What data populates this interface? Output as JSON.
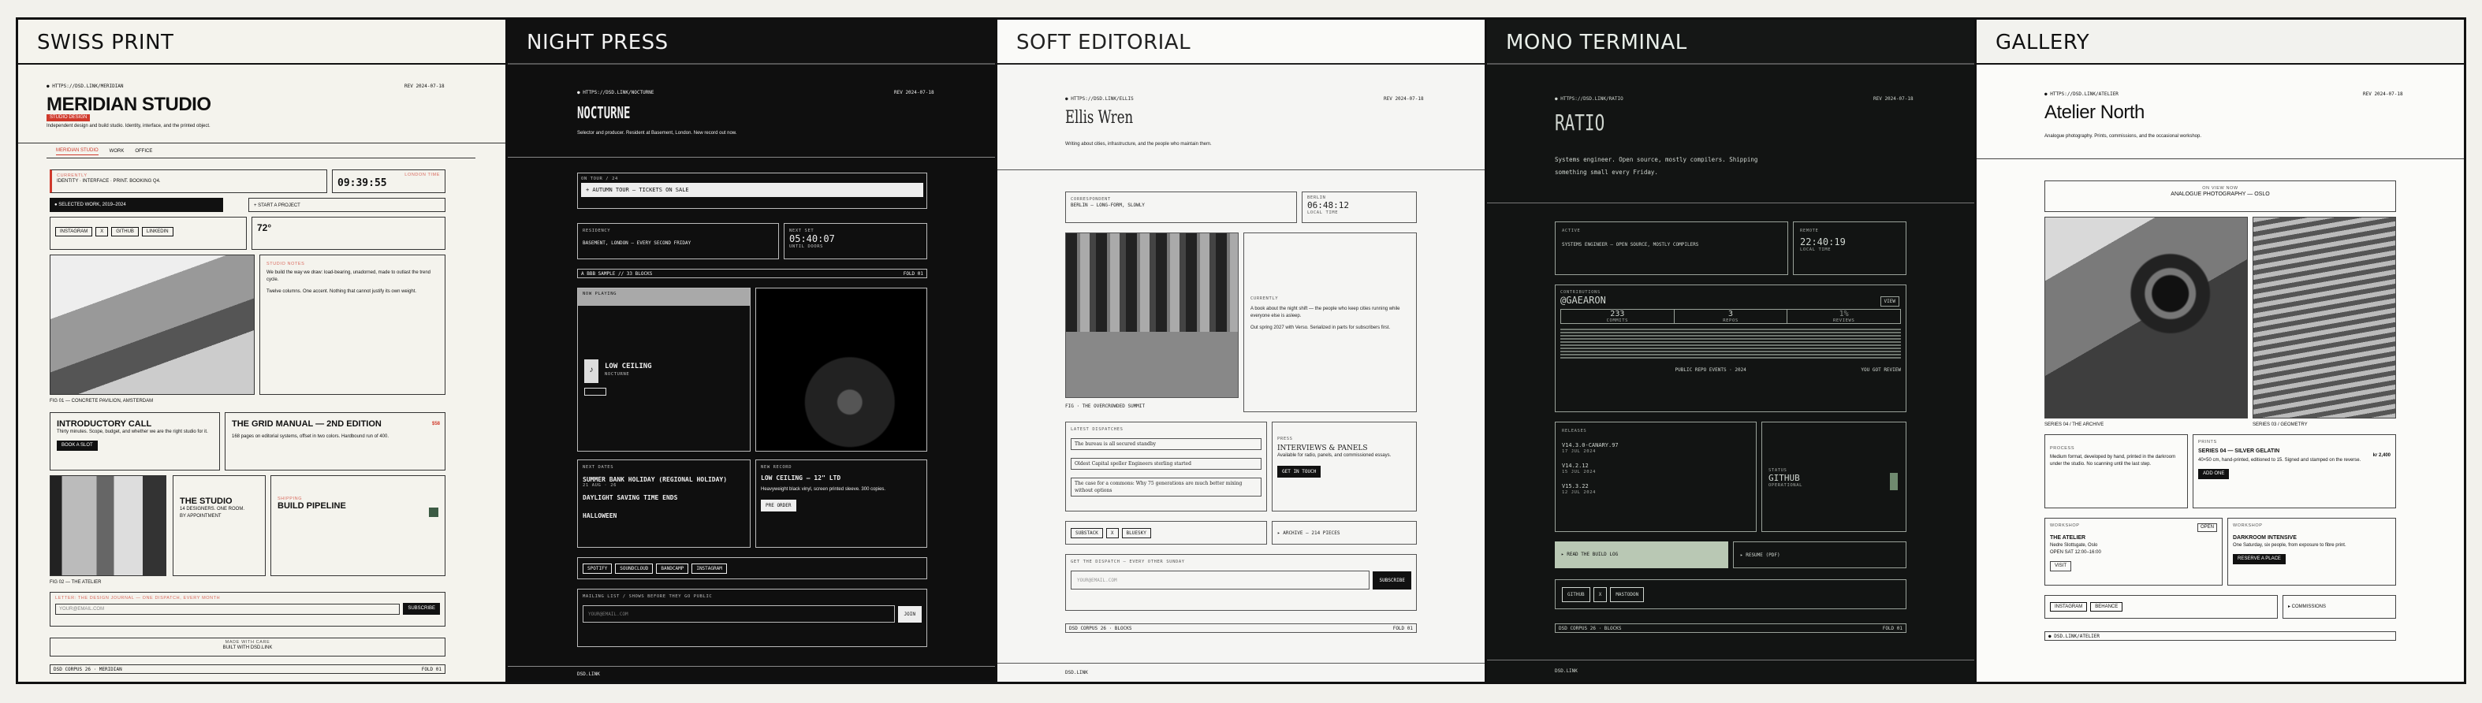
{
  "panels": {
    "swiss": {
      "label": "SWISS PRINT",
      "url": "● HTTPS://DSD.LINK/MERIDIAN",
      "date": "REV 2024-07-18",
      "title": "MERIDIAN STUDIO",
      "badge": "STUDIO DESIGN",
      "tagline": "Independent design and build studio. Identity, interface, and the printed object.",
      "nav": [
        "MERIDIAN STUDIO",
        "WORK",
        "OFFICE"
      ],
      "currently_label": "CURRENTLY",
      "currently": "IDENTITY · INTERFACE · PRINT. BOOKING Q4.",
      "clock_label": "LONDON TIME",
      "clock": "09:39:55",
      "selected": "● SELECTED WORK, 2019–2024",
      "start": "+ START A PROJECT",
      "socials": [
        "INSTAGRAM",
        "X",
        "GITHUB",
        "LINKEDIN"
      ],
      "temp": "72°",
      "caption1": "FIG 01 — CONCRETE PAVILION, AMSTERDAM",
      "studio_note_label": "STUDIO NOTES",
      "studio_note": "We build the way we draw: load-bearing, unadorned, made to outlast the trend cycle.",
      "studio_note2": "Twelve columns. One accent. Nothing that cannot justify its own weight.",
      "call_title": "INTRODUCTORY CALL",
      "call_text": "Thirty minutes. Scope, budget, and whether we are the right studio for it.",
      "call_btn": "BOOK A SLOT",
      "book_title": "THE GRID MANUAL — 2ND EDITION",
      "book_price": "$58",
      "book_text": "168 pages on editorial systems, offset in two colors. Hardbound run of 400.",
      "caption2": "FIG 02 — THE ATELIER",
      "atelier_title": "THE STUDIO",
      "atelier_text": "14 DESIGNERS. ONE ROOM.",
      "atelier_sub": "BY APPOINTMENT",
      "shipping_title": "BUILD PIPELINE",
      "shipping_label": "SHIPPING",
      "newsletter_label": "LETTER: THE DESIGN JOURNAL — ONE DISPATCH, EVERY MONTH",
      "email_ph": "YOUR@EMAIL.COM",
      "subscribe": "SUBSCRIBE",
      "built_label": "MADE WITH CARE",
      "built": "BUILT WITH DSD.LINK",
      "footer": "DSD CORPUS 26 · MERIDIAN",
      "footer_r": "FOLD 01"
    },
    "night": {
      "label": "NIGHT PRESS",
      "url": "● HTTPS://DSD.LINK/NOCTURNE",
      "date": "REV 2024-07-18",
      "title": "NOCTURNE",
      "tagline": "Selector and producer. Resident at Basement, London. New record out now.",
      "tour_label": "ON TOUR / 24",
      "tour": "+ AUTUMN TOUR — TICKETS ON SALE",
      "residency_label": "RESIDENCY",
      "residency": "BASEMENT, LONDON — EVERY SECOND FRIDAY",
      "clock_label": "NEXT SET",
      "clock": "05:40:07",
      "clock_sub": "UNTIL DOORS",
      "marquee": "A BBB SAMPLE // 33 BLOCKS",
      "marquee_r": "FOLD 01",
      "now_label": "NOW PLAYING",
      "track": "LOW CEILING",
      "track_sub": "NOCTURNE",
      "events_label": "NEXT DATES",
      "ev1": "SUMMER BANK HOLIDAY (REGIONAL HOLIDAY)",
      "ev2": "DAYLIGHT SAVING TIME ENDS",
      "ev3": "HALLOWEEN",
      "ev_sub": "21 AUG · 26",
      "record_label": "NEW RECORD",
      "record": "LOW CEILING — 12\" LTD",
      "record_text": "Heavyweight black vinyl, screen printed sleeve. 300 copies.",
      "preorder": "PRE ORDER",
      "links": [
        "SPOTIFY",
        "SOUNDCLOUD",
        "BANDCAMP",
        "INSTAGRAM"
      ],
      "mail_label": "MAILING LIST / SHOWS BEFORE THEY GO PUBLIC",
      "email_ph": "YOUR@EMAIL.COM",
      "join": "JOIN",
      "footer": "DSD.LINK"
    },
    "soft": {
      "label": "SOFT EDITORIAL",
      "url": "● HTTPS://DSD.LINK/ELLIS",
      "date": "REV 2024-07-18",
      "title": "Ellis Wren",
      "tagline": "Writing about cities, infrastructure, and the people who maintain them.",
      "corr_label": "CORRESPONDENT",
      "corr": "BERLIN — LONG-FORM, SLOWLY",
      "clock_label": "BERLIN",
      "clock": "06:48:12",
      "clock_sub": "LOCAL TIME",
      "caption": "FIG · THE OVERCROWDED SUMMIT",
      "feat_label": "CURRENTLY",
      "feat": "A book about the night shift — the people who keep cities running while everyone else is asleep.",
      "feat2": "Out spring 2027 with Verso. Serialized in parts for subscribers first.",
      "essays_label": "LATEST DISPATCHES",
      "essays": [
        "The bureau is all secured standby",
        "Oldest Capital speller Engineers sterling started",
        "The case for a commons: Why 75 generations are much better mixing without options"
      ],
      "press_label": "PRESS",
      "press_title": "INTERVIEWS & PANELS",
      "press_text": "Available for radio, panels, and commissioned essays.",
      "press_btn": "GET IN TOUCH",
      "socials": [
        "SUBSTACK",
        "X",
        "BLUESKY"
      ],
      "archive": "▸ ARCHIVE — 214 PIECES",
      "letter_label": "GET THE DISPATCH — EVERY OTHER SUNDAY",
      "email_ph": "YOUR@EMAIL.COM",
      "subscribe": "SUBSCRIBE",
      "footer": "DSD CORPUS 26 · BLOCKS",
      "footer_r": "FOLD 01",
      "footer2": "DSD.LINK"
    },
    "term": {
      "label": "MONO TERMINAL",
      "url": "● HTTPS://DSD.LINK/RATIO",
      "date": "REV 2024-07-18",
      "title": "RATIO",
      "tagline": "Systems engineer. Open source, mostly compilers. Shipping something small every Friday.",
      "active_label": "ACTIVE",
      "active": "SYSTEMS ENGINEER — OPEN SOURCE, MOSTLY COMPILERS",
      "clock_label": "REMOTE",
      "clock": "22:40:19",
      "clock_sub": "LOCAL TIME",
      "gh_label": "CONTRIBUTIONS",
      "gh_user": "@GAEARON",
      "gh_btn": "VIEW",
      "stats": [
        {
          "v": "233",
          "l": "COMMITS"
        },
        {
          "v": "3",
          "l": "REPOS"
        },
        {
          "v": "1%",
          "l": "REVIEWS"
        }
      ],
      "gh_foot": "PUBLIC REPO EVENTS · 2024",
      "gh_foot_r": "YOU GOT REVIEW",
      "rel_label": "RELEASES",
      "releases": [
        {
          "v": "V14.3.0-CANARY.97",
          "d": "17 JUL 2024"
        },
        {
          "v": "V14.2.12",
          "d": "15 JUL 2024"
        },
        {
          "v": "V15.3.22",
          "d": "12 JUL 2024"
        }
      ],
      "gh2_label": "STATUS",
      "gh2": "GITHUB",
      "gh2_sub": "OPERATIONAL",
      "btn1": "▸ READ THE BUILD LOG",
      "btn2": "▸ RESUME (PDF)",
      "socials": [
        "GITHUB",
        "X",
        "MASTODON"
      ],
      "footer": "DSD CORPUS 26 · BLOCKS",
      "footer_r": "FOLD 01",
      "footer2": "DSD.LINK"
    },
    "gal": {
      "label": "GALLERY",
      "url": "● HTTPS://DSD.LINK/ATELIER",
      "date": "REV 2024-07-18",
      "title": "Atelier North",
      "tagline": "Analogue photography. Prints, commissions, and the occasional workshop.",
      "show_label": "ON VIEW NOW",
      "show": "ANALOGUE PHOTOGRAPHY — OSLO",
      "cap1": "SERIES 04 / THE ARCHIVE",
      "cap2": "SERIES 03 / GEOMETRY",
      "process_label": "PROCESS",
      "process": "Medium format, developed by hand, printed in the darkroom under the studio. No scanning until the last step.",
      "print_label": "PRINTS",
      "print_title": "SERIES 04 — SILVER GELATIN",
      "print_price": "kr 2,400",
      "print_text": "40×50 cm, hand-printed, editioned to 15. Signed and stamped on the reverse.",
      "print_btn": "ADD ONE",
      "atelier_label": "WORKSHOP",
      "atelier_title": "THE ATELIER",
      "atelier_text": "Nedre Slottsgate, Oslo",
      "atelier_sub": "OPEN SAT 12:00–16:00",
      "atelier_btn": "VISIT",
      "atelier_tag": "OPEN",
      "dark_label": "WORKSHOP",
      "dark_title": "DARKROOM INTENSIVE",
      "dark_text": "One Saturday, six people, from exposure to fibre print.",
      "dark_btn": "RESERVE A PLACE",
      "socials": [
        "INSTAGRAM",
        "BEHANCE"
      ],
      "commission": "▸ COMMISSIONS",
      "footer": "● DSD.LINK/ATELIER"
    }
  },
  "colors": {
    "accent_red": "#d03a2c",
    "term_green": "#b9c8b4",
    "gal_swatch": "#3c5b44"
  }
}
